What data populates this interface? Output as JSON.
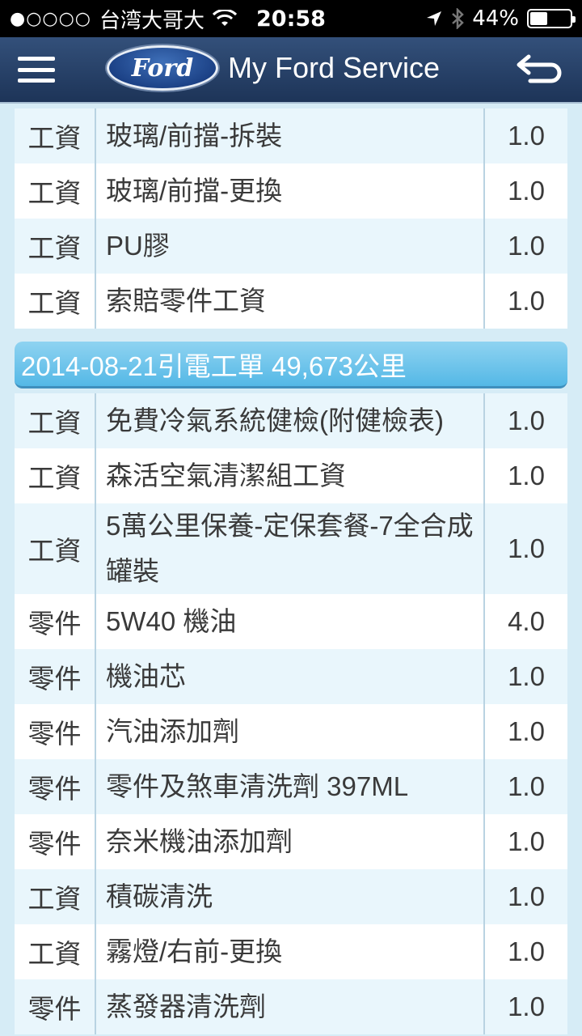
{
  "status": {
    "carrier": "台湾大哥大",
    "signal": "●○○○○",
    "time": "20:58",
    "battery": "44%",
    "battery_level": 0.44
  },
  "nav": {
    "logo_text": "Ford",
    "title": "My Ford Service"
  },
  "table1": {
    "rows": [
      {
        "type": "工資",
        "desc": "玻璃/前擋-拆裝",
        "qty": "1.0"
      },
      {
        "type": "工資",
        "desc": "玻璃/前擋-更換",
        "qty": "1.0"
      },
      {
        "type": "工資",
        "desc": "PU膠",
        "qty": "1.0"
      },
      {
        "type": "工資",
        "desc": "索賠零件工資",
        "qty": "1.0"
      }
    ]
  },
  "section": {
    "title": "2014-08-21引電工單 49,673公里"
  },
  "table2": {
    "rows": [
      {
        "type": "工資",
        "desc": "免費冷氣系統健檢(附健檢表)",
        "qty": "1.0"
      },
      {
        "type": "工資",
        "desc": "森活空氣清潔組工資",
        "qty": "1.0"
      },
      {
        "type": "工資",
        "desc": "5萬公里保養-定保套餐-7全合成罐裝",
        "qty": "1.0"
      },
      {
        "type": "零件",
        "desc": "5W40 機油",
        "qty": "4.0"
      },
      {
        "type": "零件",
        "desc": "機油芯",
        "qty": "1.0"
      },
      {
        "type": "零件",
        "desc": "汽油添加劑",
        "qty": "1.0"
      },
      {
        "type": "零件",
        "desc": "零件及煞車清洗劑 397ML",
        "qty": "1.0"
      },
      {
        "type": "零件",
        "desc": "奈米機油添加劑",
        "qty": "1.0"
      },
      {
        "type": "工資",
        "desc": "積碳清洗",
        "qty": "1.0"
      },
      {
        "type": "工資",
        "desc": "霧燈/右前-更換",
        "qty": "1.0"
      },
      {
        "type": "零件",
        "desc": "蒸發器清洗劑",
        "qty": "1.0"
      }
    ]
  }
}
